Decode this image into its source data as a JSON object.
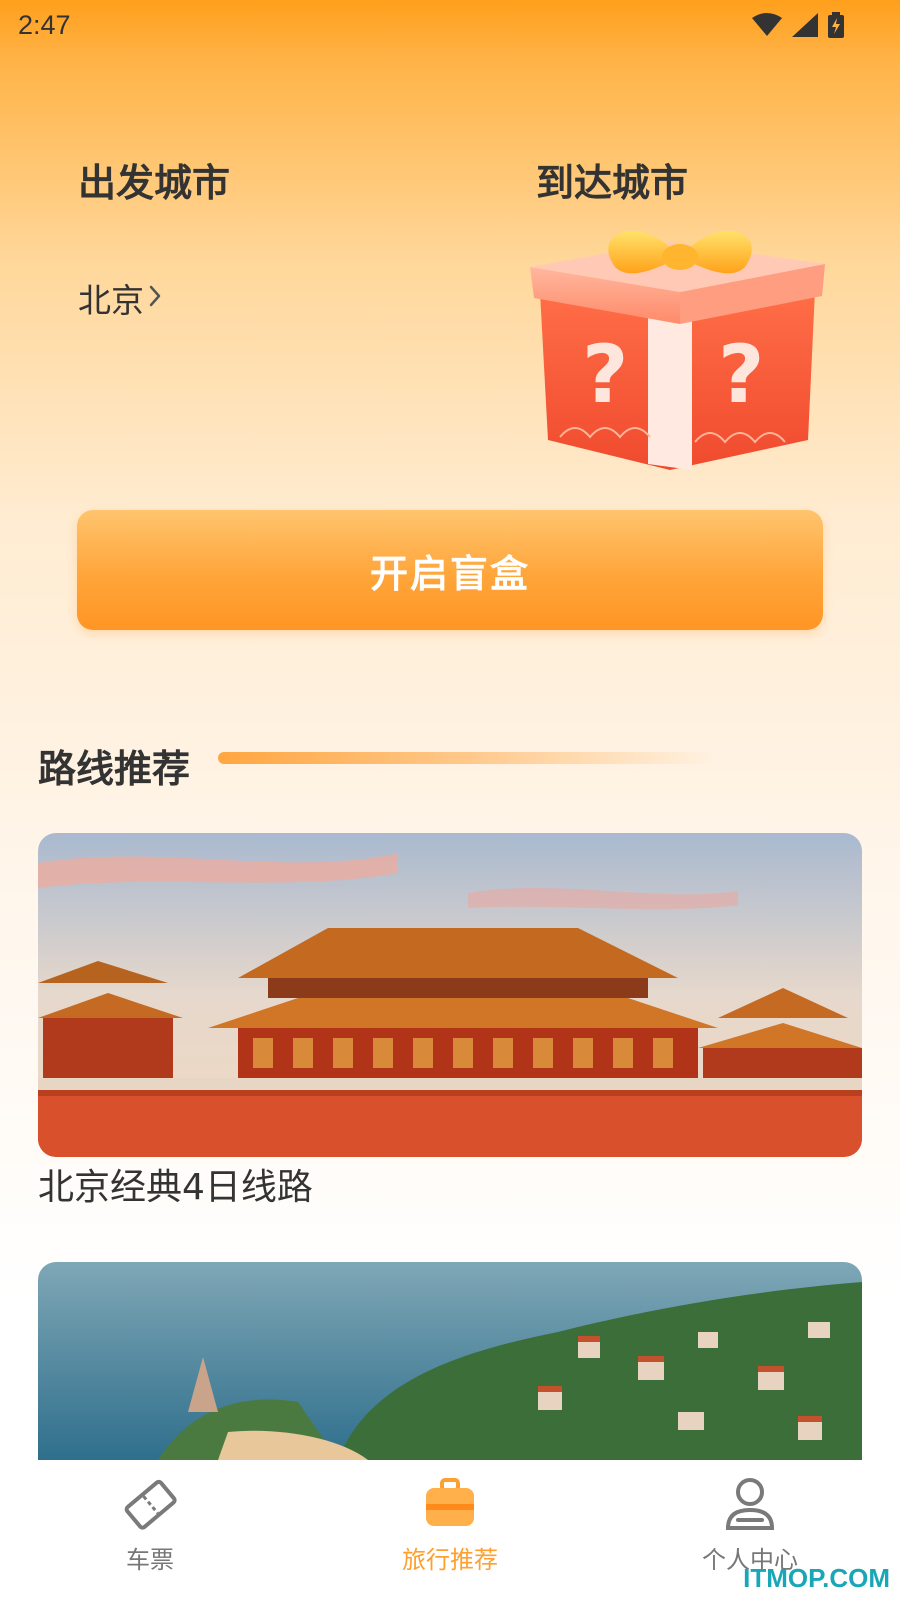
{
  "status_bar": {
    "time": "2:47",
    "icons": [
      "wifi-icon",
      "signal-icon",
      "battery-charging-icon"
    ]
  },
  "blind_box": {
    "depart_label": "出发城市",
    "arrive_label": "到达城市",
    "depart_city": "北京",
    "arrive_placeholder_icon": "mystery-gift-box-icon",
    "open_button_label": "开启盲盒"
  },
  "recommend": {
    "section_title": "路线推荐",
    "routes": [
      {
        "name": "北京经典4日线路",
        "image": "forbidden-city-photo"
      },
      {
        "name": "",
        "image": "coastal-town-photo"
      }
    ]
  },
  "tab_bar": {
    "items": [
      {
        "label": "车票",
        "icon": "ticket-icon",
        "active": false
      },
      {
        "label": "旅行推荐",
        "icon": "suitcase-icon",
        "active": true
      },
      {
        "label": "个人中心",
        "icon": "person-icon",
        "active": false
      }
    ]
  },
  "watermark": "ITMOP.COM",
  "colors": {
    "accent": "#ff9f2e",
    "header_gradient_top": "#ff9f1c",
    "text_primary": "#333333",
    "tab_inactive": "#777777",
    "watermark": "#19a7b8"
  }
}
